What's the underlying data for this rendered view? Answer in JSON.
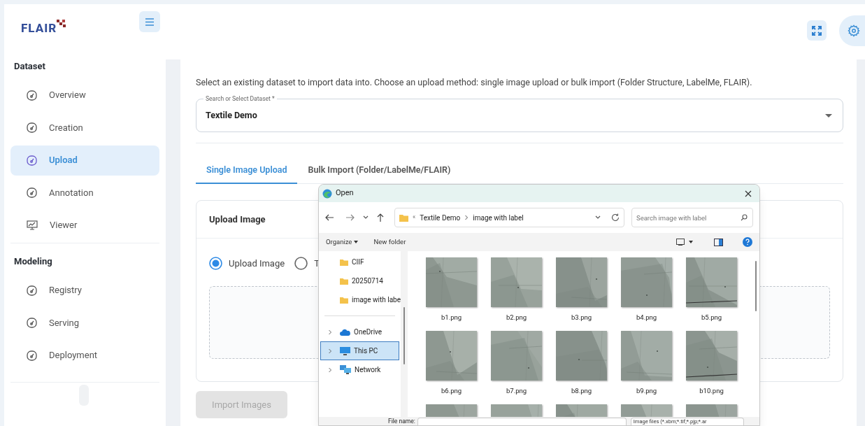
{
  "logo": {
    "text": "FLAIR"
  },
  "sidebar": [
    {
      "title": "Dataset",
      "items": [
        {
          "label": "Overview",
          "kind": "gauge",
          "selected": false
        },
        {
          "label": "Creation",
          "kind": "gauge",
          "selected": false
        },
        {
          "label": "Upload",
          "kind": "gauge",
          "selected": true
        },
        {
          "label": "Annotation",
          "kind": "gauge",
          "selected": false
        },
        {
          "label": "Viewer",
          "kind": "monitor",
          "selected": false
        }
      ]
    },
    {
      "title": "Modeling",
      "items": [
        {
          "label": "Registry",
          "kind": "gauge",
          "selected": false
        },
        {
          "label": "Serving",
          "kind": "gauge",
          "selected": false
        },
        {
          "label": "Deployment",
          "kind": "gauge",
          "selected": false
        }
      ]
    }
  ],
  "intro": "Select an existing dataset to import data into. Choose an upload method: single image upload or bulk import (Folder Structure, LabelMe, FLAIR).",
  "dataset_select": {
    "label": "Search or Select Dataset *",
    "value": "Textile Demo"
  },
  "tabs": [
    {
      "label": "Single Image Upload",
      "selected": true
    },
    {
      "label": "Bulk Import (Folder/LabelMe/FLAIR)",
      "selected": false
    }
  ],
  "card": {
    "title": "Upload Image",
    "radios": [
      {
        "label": "Upload Image",
        "checked": true
      },
      {
        "label": "T",
        "checked": false
      }
    ]
  },
  "import_button": {
    "label": "Import Images",
    "disabled": true
  },
  "dialog": {
    "title": "Open",
    "path_overflow": "«",
    "path": [
      "Textile Demo",
      "image with label"
    ],
    "search": {
      "placeholder": "Search image with label"
    },
    "toolbar": {
      "organize": "Organize",
      "new_folder": "New folder"
    },
    "quick_access": [
      {
        "label": "CIIF"
      },
      {
        "label": "20250714"
      },
      {
        "label": "image with labe"
      }
    ],
    "locations": [
      {
        "label": "OneDrive",
        "kind": "cloud",
        "selected": false
      },
      {
        "label": "This PC",
        "kind": "pc",
        "selected": true
      },
      {
        "label": "Network",
        "kind": "network",
        "selected": false
      }
    ],
    "files": [
      {
        "name": "b1.png"
      },
      {
        "name": "b2.png"
      },
      {
        "name": "b3.png"
      },
      {
        "name": "b4.png"
      },
      {
        "name": "b5.png"
      },
      {
        "name": "b6.png"
      },
      {
        "name": "b7.png"
      },
      {
        "name": "b8.png"
      },
      {
        "name": "b9.png"
      },
      {
        "name": "b10.png"
      }
    ],
    "partial_files": [
      {
        "kind": "picture"
      },
      {
        "kind": "picture"
      },
      {
        "kind": "picture"
      },
      {
        "kind": "picture"
      },
      {
        "kind": "picture"
      }
    ],
    "file_name_label": "File name:",
    "filter": "Image files (*.xbm;*.tif;*.pjp;*.ar"
  }
}
